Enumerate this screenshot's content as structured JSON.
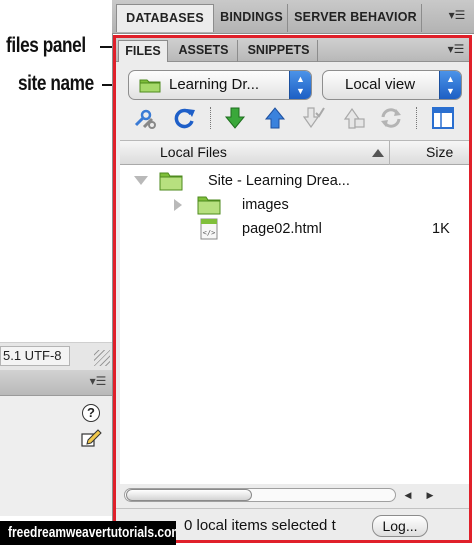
{
  "annotations": {
    "files_panel": "files panel",
    "site_name": "site name"
  },
  "left_window": {
    "encoding": "5.1 UTF-8",
    "help_icon": "?"
  },
  "panel_group": {
    "tabs": [
      {
        "label": "DATABASES",
        "active": true
      },
      {
        "label": "BINDINGS",
        "active": false
      },
      {
        "label": "SERVER BEHAVIOR",
        "active": false
      }
    ],
    "menu_icon": "options-menu-icon"
  },
  "files_panel": {
    "tabs": [
      {
        "label": "FILES",
        "active": true
      },
      {
        "label": "ASSETS",
        "active": false
      },
      {
        "label": "SNIPPETS",
        "active": false
      }
    ],
    "site_select": {
      "value": "Learning Dr..."
    },
    "view_select": {
      "value": "Local view"
    },
    "toolbar": [
      "connect-icon",
      "refresh-icon",
      "get-files-icon",
      "put-files-icon",
      "check-out-icon",
      "check-in-icon",
      "synchronize-icon",
      "expand-icon"
    ],
    "columns": {
      "local_files": "Local Files",
      "size": "Size"
    },
    "files": [
      {
        "name": "Site - Learning Drea...",
        "type": "site-root",
        "size": "",
        "expanded": true
      },
      {
        "name": "images",
        "type": "folder",
        "size": "",
        "expanded": false
      },
      {
        "name": "page02.html",
        "type": "html-file",
        "size": "1K"
      }
    ],
    "status": "0 local items selected t",
    "log_button": "Log..."
  },
  "watermark": "freedreamweavertutorials.com",
  "colors": {
    "highlight_border": "#e0202a",
    "select_stepper": "#2f75d6",
    "folder_green": "#8cc63f",
    "arrow_green": "#2e9e2e",
    "arrow_blue": "#2a6fd0"
  }
}
